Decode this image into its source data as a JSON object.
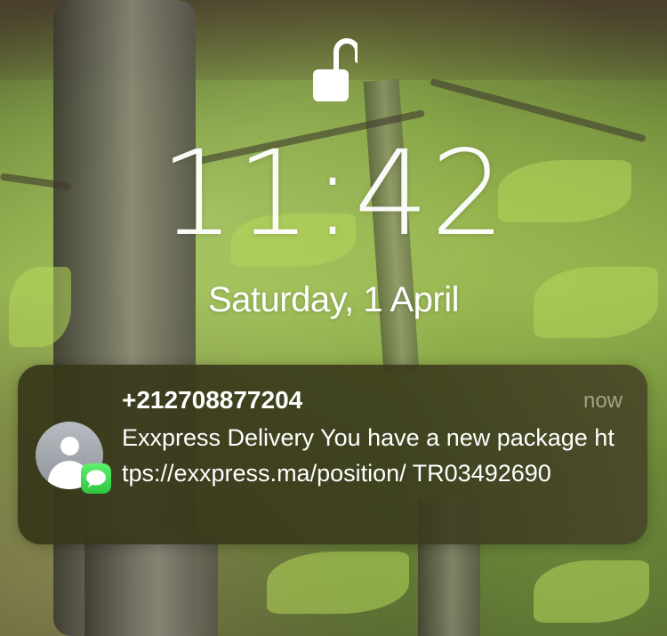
{
  "lock_screen": {
    "lock_icon": "unlocked-padlock-icon",
    "time": "11:42",
    "date": "Saturday, 1 April"
  },
  "notification": {
    "avatar_icon": "contact-avatar-icon",
    "app_icon": "messages-icon",
    "app_color": "#34c759",
    "sender": "+212708877204",
    "timestamp": "now",
    "message": "Exxpress Delivery You have a new package https://exxpress.ma/position/ TR03492690"
  }
}
